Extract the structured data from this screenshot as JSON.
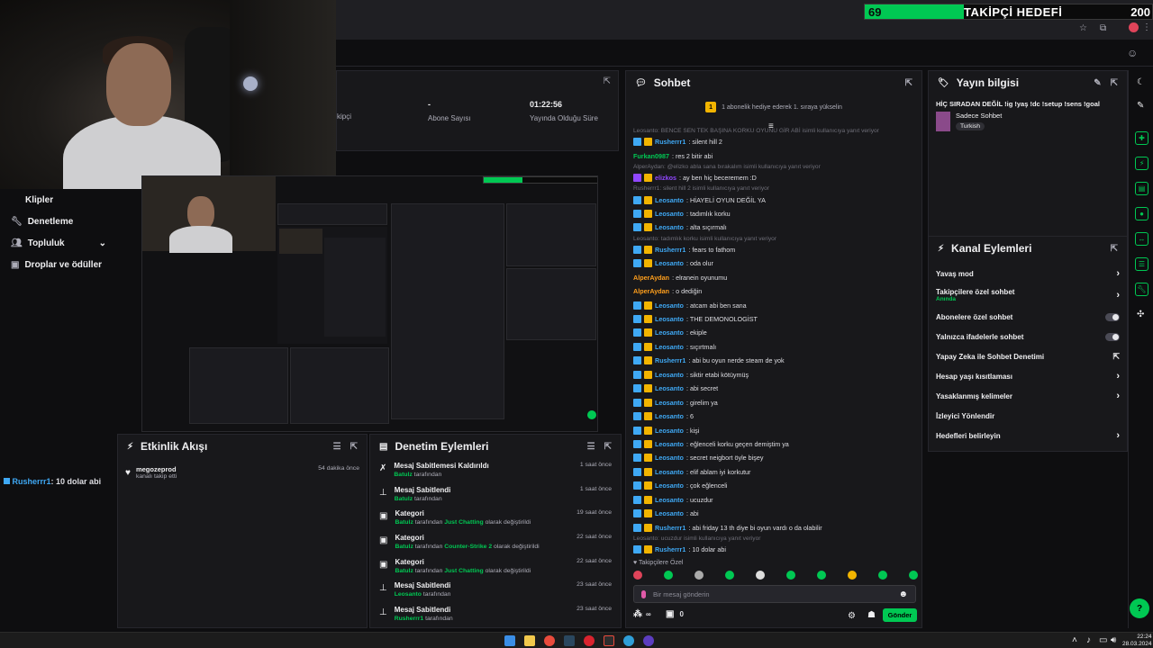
{
  "goal": {
    "current": "69",
    "label": "TAKİPÇİ HEDEFİ",
    "target": "200",
    "progress_fraction": 0.345,
    "color": "#00c853"
  },
  "stats": {
    "followers_label": "kipçi",
    "subs_value": "-",
    "subs_label": "Abone Sayısı",
    "uptime_value": "01:22:56",
    "uptime_label": "Yayında Olduğu Süre"
  },
  "left_nav": {
    "items": [
      {
        "label": "Klipler"
      },
      {
        "label": "Denetleme"
      },
      {
        "label": "Topluluk"
      },
      {
        "label": "Droplar ve ödüller"
      }
    ]
  },
  "left_chat": {
    "user": "Rusherrr1",
    "text": ": 10 dolar abi"
  },
  "chat": {
    "title": "Sohbet",
    "banner": "1 abonelik hediye ederek 1. sıraya yükselin",
    "messages": [
      {
        "reply": "Leosanto: BENCE SEN TEK BAŞINA KORKU OYUNU GİR ABİ isimli kullanıcıya yanıt veriyor"
      },
      {
        "user": "Rusherrr1",
        "color": "#3fa9f5",
        "text": ": silent hill 2",
        "badge": "#3fa9f5"
      },
      {
        "user": "Furkan0987",
        "color": "#00c853",
        "text": ": res 2 bitir abi"
      },
      {
        "reply": "AlperAydan: @elizko abla sana bırakalım isimli kullanıcıya yanıt veriyor"
      },
      {
        "user": "elizkos",
        "color": "#9147ff",
        "text": ": ay ben hiç beceremem :D",
        "badge": "#9147ff"
      },
      {
        "reply": "Rusherrr1: silent hill 2 isimli kullanıcıya yanıt veriyor"
      },
      {
        "user": "Leosanto",
        "color": "#3fa9f5",
        "text": ": HİAYELİ OYUN DEĞİL YA",
        "badge": "#3fa9f5"
      },
      {
        "user": "Leosanto",
        "color": "#3fa9f5",
        "text": ": tadımlık korku",
        "badge": "#3fa9f5"
      },
      {
        "user": "Leosanto",
        "color": "#3fa9f5",
        "text": ": alta sıçırmalı",
        "badge": "#3fa9f5"
      },
      {
        "reply": "Leosanto: tadımlık korku isimli kullanıcıya yanıt veriyor"
      },
      {
        "user": "Rusherrr1",
        "color": "#3fa9f5",
        "text": ": fears to fathom",
        "badge": "#3fa9f5"
      },
      {
        "user": "Leosanto",
        "color": "#3fa9f5",
        "text": ": oda olur",
        "badge": "#3fa9f5"
      },
      {
        "user": "AlperAydan",
        "color": "#ff9f1c",
        "text": ": elranein oyunumu"
      },
      {
        "user": "AlperAydan",
        "color": "#ff9f1c",
        "text": ": o dediğin"
      },
      {
        "user": "Leosanto",
        "color": "#3fa9f5",
        "text": ": atcam abi ben sana",
        "badge": "#3fa9f5"
      },
      {
        "user": "Leosanto",
        "color": "#3fa9f5",
        "text": ": THE DEMONOLOGİST",
        "badge": "#3fa9f5"
      },
      {
        "user": "Leosanto",
        "color": "#3fa9f5",
        "text": ": ekiple",
        "badge": "#3fa9f5"
      },
      {
        "user": "Leosanto",
        "color": "#3fa9f5",
        "text": ": sıçırtmalı",
        "badge": "#3fa9f5"
      },
      {
        "user": "Rusherrr1",
        "color": "#3fa9f5",
        "text": ": abi bu oyun nerde steam de yok",
        "badge": "#3fa9f5"
      },
      {
        "user": "Leosanto",
        "color": "#3fa9f5",
        "text": ": siktir etabi kötüymüş",
        "badge": "#3fa9f5"
      },
      {
        "user": "Leosanto",
        "color": "#3fa9f5",
        "text": ": abi secret",
        "badge": "#3fa9f5"
      },
      {
        "user": "Leosanto",
        "color": "#3fa9f5",
        "text": ": girelim ya",
        "badge": "#3fa9f5"
      },
      {
        "user": "Leosanto",
        "color": "#3fa9f5",
        "text": ": 6",
        "badge": "#3fa9f5"
      },
      {
        "user": "Leosanto",
        "color": "#3fa9f5",
        "text": ": kişi",
        "badge": "#3fa9f5"
      },
      {
        "user": "Leosanto",
        "color": "#3fa9f5",
        "text": ": eğlenceli korku geçen demiştim ya",
        "badge": "#3fa9f5"
      },
      {
        "user": "Leosanto",
        "color": "#3fa9f5",
        "text": ": secret neigbort öyle bişey",
        "badge": "#3fa9f5"
      },
      {
        "user": "Leosanto",
        "color": "#3fa9f5",
        "text": ": elif ablam iyi korkutur",
        "badge": "#3fa9f5"
      },
      {
        "user": "Leosanto",
        "color": "#3fa9f5",
        "text": ": çok eğlenceli",
        "badge": "#3fa9f5"
      },
      {
        "user": "Leosanto",
        "color": "#3fa9f5",
        "text": ": ucuzdur",
        "badge": "#3fa9f5"
      },
      {
        "user": "Leosanto",
        "color": "#3fa9f5",
        "text": ": abi",
        "badge": "#3fa9f5"
      },
      {
        "user": "Rusherrr1",
        "color": "#3fa9f5",
        "text": ": abi friday 13 th diye bi oyun vardı o da olabilir",
        "badge": "#3fa9f5"
      },
      {
        "reply": "Leosanto: ucuzdur isimli kullanıcıya yanıt veriyor"
      },
      {
        "user": "Rusherrr1",
        "color": "#3fa9f5",
        "text": ": 10 dolar abi",
        "badge": "#3fa9f5"
      }
    ],
    "followers_only": "Takipçilere Özel",
    "input_placeholder": "Bir mesaj gönderin",
    "points": "∞",
    "gift_count": "0",
    "send_label": "Gönder"
  },
  "stream_info": {
    "title": "Yayın bilgisi",
    "stream_title": "HİÇ SIRADAN DEĞİL !ig !yaş !dc !setup !sens !goal",
    "category": "Sadece Sohbet",
    "tag": "Turkish"
  },
  "channel_actions": {
    "title": "Kanal Eylemleri",
    "rows": [
      {
        "label": "Yavaş mod",
        "type": "chevron"
      },
      {
        "label": "Takipçilere özel sohbet",
        "sub": "Anında",
        "type": "chevron"
      },
      {
        "label": "Abonelere özel sohbet",
        "type": "toggle"
      },
      {
        "label": "Yalnızca ifadelerle sohbet",
        "type": "toggle"
      },
      {
        "label": "Yapay Zeka ile Sohbet Denetimi",
        "type": "external"
      },
      {
        "label": "Hesap yaşı kısıtlaması",
        "type": "chevron"
      },
      {
        "label": "Yasaklanmış kelimeler",
        "type": "chevron"
      },
      {
        "label": "İzleyici Yönlendir",
        "type": "none"
      },
      {
        "label": "Hedefleri belirleyin",
        "type": "chevron"
      }
    ]
  },
  "activity": {
    "title": "Etkinlik Akışı",
    "items": [
      {
        "user": "megozeprod",
        "sub": "kanalı takip etti",
        "time": "54 dakika önce"
      }
    ]
  },
  "modlog": {
    "title": "Denetim Eylemleri",
    "items": [
      {
        "icon": "unpin",
        "title": "Mesaj Sabitlemesi Kaldırıldı",
        "by": "Batulz",
        "rest": " tarafından",
        "time": "1 saat önce"
      },
      {
        "icon": "pin",
        "title": "Mesaj Sabitlendi",
        "by": "Batulz",
        "rest": " tarafından",
        "time": "1 saat önce"
      },
      {
        "icon": "category",
        "title": "Kategori",
        "by": "Batulz",
        "rest": " tarafından ",
        "hl": "Just Chatting",
        "tail": " olarak değiştirildi",
        "time": "19 saat önce"
      },
      {
        "icon": "category",
        "title": "Kategori",
        "by": "Batulz",
        "rest": " tarafından ",
        "hl": "Counter-Strike 2",
        "tail": " olarak değiştirildi",
        "time": "22 saat önce"
      },
      {
        "icon": "category",
        "title": "Kategori",
        "by": "Batulz",
        "rest": " tarafından ",
        "hl": "Just Chatting",
        "tail": " olarak değiştirildi",
        "time": "22 saat önce"
      },
      {
        "icon": "pin",
        "title": "Mesaj Sabitlendi",
        "by": "Leosanto",
        "rest": " tarafından",
        "time": "23 saat önce"
      },
      {
        "icon": "pin",
        "title": "Mesaj Sabitlendi",
        "by": "Rusherrr1",
        "rest": " tarafından",
        "time": "23 saat önce"
      }
    ]
  },
  "taskbar": {
    "time": "22:24",
    "date": "28.03.2024"
  },
  "colors": {
    "accent": "#00c853",
    "bg": "#0e0e10",
    "panel": "#18181b"
  }
}
